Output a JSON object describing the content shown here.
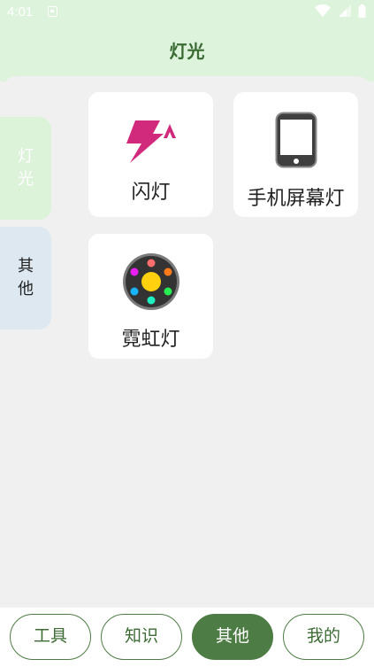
{
  "status_bar": {
    "time": "4:01"
  },
  "header": {
    "title": "灯光"
  },
  "sidebar": {
    "items": [
      {
        "label": "灯光",
        "selected": true
      },
      {
        "label": "其他",
        "selected": false
      }
    ]
  },
  "cards": [
    {
      "label": "闪灯",
      "icon": "flash-icon"
    },
    {
      "label": "手机屏幕灯",
      "icon": "phone-screen-icon"
    },
    {
      "label": "霓虹灯",
      "icon": "neon-light-icon"
    }
  ],
  "bottom_nav": {
    "items": [
      {
        "label": "工具",
        "active": false
      },
      {
        "label": "知识",
        "active": false
      },
      {
        "label": "其他",
        "active": true
      },
      {
        "label": "我的",
        "active": false
      }
    ]
  },
  "colors": {
    "accent": "#4d7c44",
    "header_bg": "#def3dc",
    "flash_icon": "#d12a7c"
  }
}
